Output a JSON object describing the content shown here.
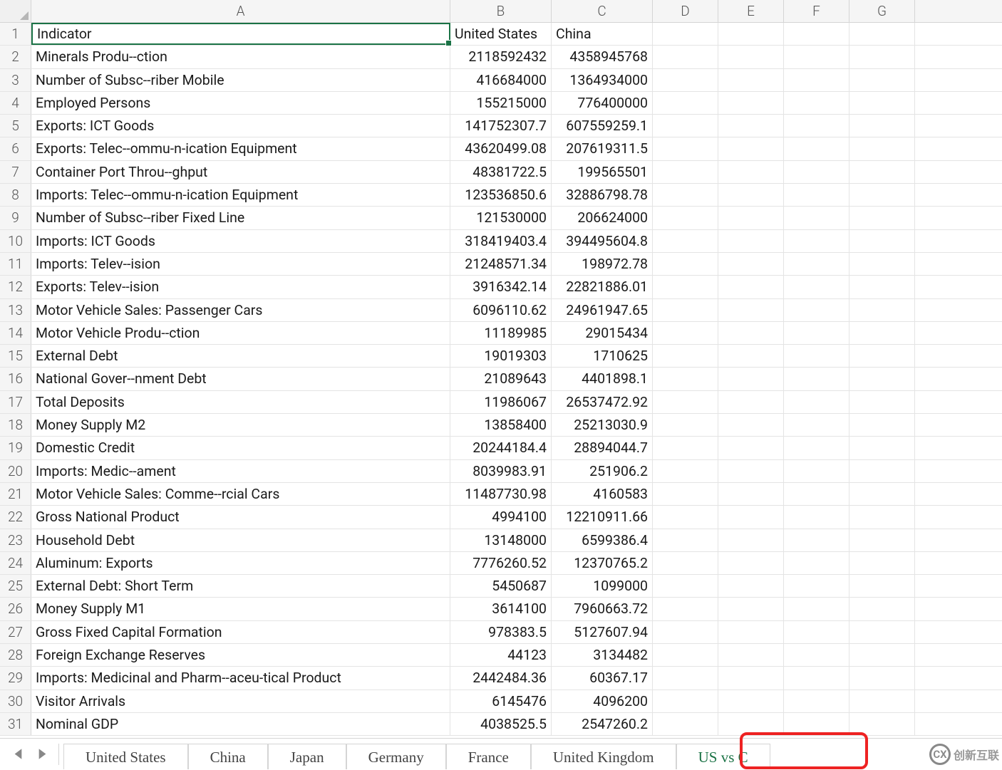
{
  "columns": [
    "A",
    "B",
    "C",
    "D",
    "E",
    "F",
    "G"
  ],
  "active_cell": "A1",
  "rows": [
    {
      "n": 1,
      "a": "Indicator",
      "b": "United States",
      "c": "China"
    },
    {
      "n": 2,
      "a": "Minerals Produ--ction",
      "b": "2118592432",
      "c": "4358945768"
    },
    {
      "n": 3,
      "a": "Number of Subsc--riber Mobile",
      "b": "416684000",
      "c": "1364934000"
    },
    {
      "n": 4,
      "a": "Employed Persons",
      "b": "155215000",
      "c": "776400000"
    },
    {
      "n": 5,
      "a": "Exports: ICT Goods",
      "b": "141752307.7",
      "c": "607559259.1"
    },
    {
      "n": 6,
      "a": "Exports: Telec--ommu-n-ication Equipment",
      "b": "43620499.08",
      "c": "207619311.5"
    },
    {
      "n": 7,
      "a": "Container Port Throu--ghput",
      "b": "48381722.5",
      "c": "199565501"
    },
    {
      "n": 8,
      "a": "Imports: Telec--ommu-n-ication Equipment",
      "b": "123536850.6",
      "c": "32886798.78"
    },
    {
      "n": 9,
      "a": "Number of Subsc--riber Fixed Line",
      "b": "121530000",
      "c": "206624000"
    },
    {
      "n": 10,
      "a": "Imports: ICT Goods",
      "b": "318419403.4",
      "c": "394495604.8"
    },
    {
      "n": 11,
      "a": "Imports: Telev--ision",
      "b": "21248571.34",
      "c": "198972.78"
    },
    {
      "n": 12,
      "a": "Exports: Telev--ision",
      "b": "3916342.14",
      "c": "22821886.01"
    },
    {
      "n": 13,
      "a": "Motor Vehicle Sales: Passenger Cars",
      "b": "6096110.62",
      "c": "24961947.65"
    },
    {
      "n": 14,
      "a": "Motor Vehicle Produ--ction",
      "b": "11189985",
      "c": "29015434"
    },
    {
      "n": 15,
      "a": "External Debt",
      "b": "19019303",
      "c": "1710625"
    },
    {
      "n": 16,
      "a": "National Gover--nment Debt",
      "b": "21089643",
      "c": "4401898.1"
    },
    {
      "n": 17,
      "a": "Total Deposits",
      "b": "11986067",
      "c": "26537472.92"
    },
    {
      "n": 18,
      "a": "Money Supply M2",
      "b": "13858400",
      "c": "25213030.9"
    },
    {
      "n": 19,
      "a": "Domestic Credit",
      "b": "20244184.4",
      "c": "28894044.7"
    },
    {
      "n": 20,
      "a": "Imports: Medic--ament",
      "b": "8039983.91",
      "c": "251906.2"
    },
    {
      "n": 21,
      "a": "Motor Vehicle Sales: Comme--rcial Cars",
      "b": "11487730.98",
      "c": "4160583"
    },
    {
      "n": 22,
      "a": "Gross National Product",
      "b": "4994100",
      "c": "12210911.66"
    },
    {
      "n": 23,
      "a": "Household Debt",
      "b": "13148000",
      "c": "6599386.4"
    },
    {
      "n": 24,
      "a": "Aluminum: Exports",
      "b": "7776260.52",
      "c": "12370765.2"
    },
    {
      "n": 25,
      "a": "External Debt: Short Term",
      "b": "5450687",
      "c": "1099000"
    },
    {
      "n": 26,
      "a": "Money Supply M1",
      "b": "3614100",
      "c": "7960663.72"
    },
    {
      "n": 27,
      "a": "Gross Fixed Capital Formation",
      "b": "978383.5",
      "c": "5127607.94"
    },
    {
      "n": 28,
      "a": "Foreign Exchange Reserves",
      "b": "44123",
      "c": "3134482"
    },
    {
      "n": 29,
      "a": "Imports: Medicinal and Pharm--aceu-tical Product",
      "b": "2442484.36",
      "c": "60367.17"
    },
    {
      "n": 30,
      "a": "Visitor Arrivals",
      "b": "6145476",
      "c": "4096200"
    },
    {
      "n": 31,
      "a": "Nominal GDP",
      "b": "4038525.5",
      "c": "2547260.2"
    }
  ],
  "tabs": [
    {
      "label": "United States",
      "active": false
    },
    {
      "label": "China",
      "active": false
    },
    {
      "label": "Japan",
      "active": false
    },
    {
      "label": "Germany",
      "active": false
    },
    {
      "label": "France",
      "active": false
    },
    {
      "label": "United Kingdom",
      "active": false
    },
    {
      "label": "US vs C",
      "active": true
    }
  ],
  "watermark": {
    "text": "创新互联",
    "icon": "CX"
  }
}
